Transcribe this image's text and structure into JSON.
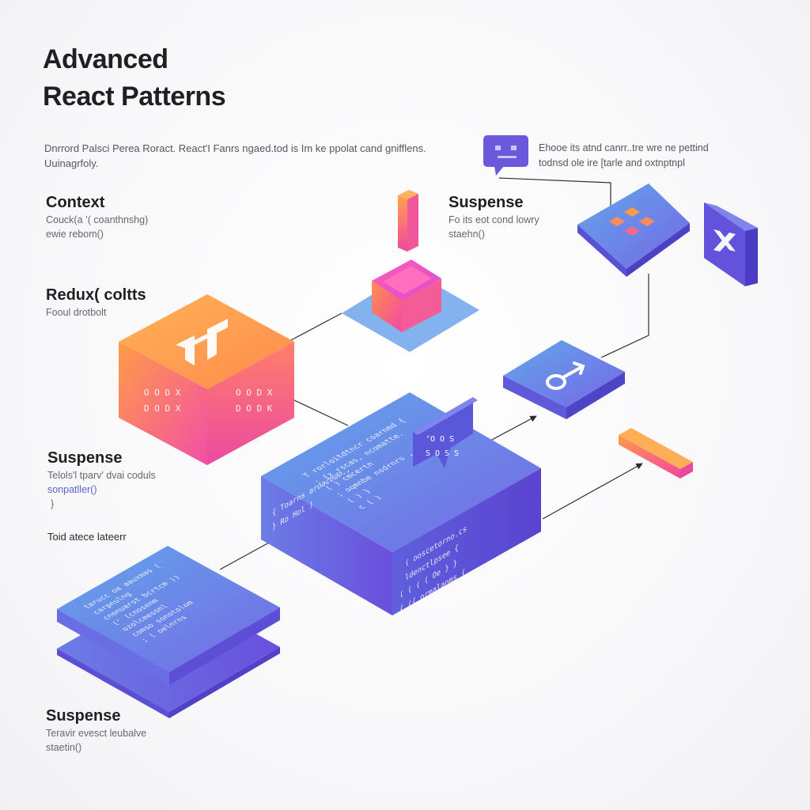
{
  "title": {
    "line1": "Advanced",
    "line2": "React Patterns"
  },
  "intro": {
    "line1": "Dnrrord Palsci Perea Roract. React'I Fanrs ngaed.tod is Im ke ppolat cand gnifflens.",
    "line2": "Uuinagrfoly."
  },
  "labels": {
    "context": {
      "heading": "Context",
      "line1": "Couck(a ’( coanthnshg)",
      "line2": "ewie rebom()"
    },
    "suspense_top": {
      "heading": "Suspense",
      "line1": "Fo its eot cond lowry",
      "line2": "staehn()"
    },
    "redux": {
      "heading": "Redux( coltts",
      "line1": "Fooul drotbolt"
    },
    "suspense_mid": {
      "heading": "Suspense",
      "line1": "Telols'l tparv' dvai coduls",
      "line2": "sonpatller()",
      "line3": "}"
    },
    "tool": {
      "heading": "Toid atece lateerr"
    },
    "suspense_bottom": {
      "heading": "Suspense",
      "line1": "Teravir evesct leubalve",
      "line2": "staetin()"
    }
  },
  "callout": {
    "line1": "Ehooe its atnd canrr..tre wre ne pettind",
    "line2": "todnsd ole ire [tarle and oxtnptnpl"
  },
  "blocks": {
    "big_cube_face": [
      "O O D X",
      "D O D X"
    ],
    "big_cube_side": [
      "O O D X",
      "D O D K"
    ],
    "bubble_code": [
      "‘O O S",
      "S O S S"
    ],
    "center_code": [
      "T rorloitdtncr coarnmd  {",
      ": {z rscas, ncomatte.",
      "( )   cmcertn",
      "; oqmnbe nsdrnrs  ,",
      "(   )        }",
      "c ( )",
      "{ Toarns aroacodo.,",
      "}  Ro Hol )",
      "(   ooscetorno.cs",
      "   ldenctlpsee {",
      "( (    (  ( Oe } }",
      "{ ({ ormalanms {"
    ],
    "stack_code": [
      "tarucc oa aauxmas  (",
      "  carpnulng",
      "cnonuarst bcrtcm   ))",
      "  (' (cnosenm",
      "   ozolcmesonl",
      "   comso  sonotolom",
      "   ; (  oelnrns"
    ]
  },
  "colors": {
    "accent_purple": "#6a55e0",
    "accent_blue": "#5b93e8",
    "accent_orange": "#ff9a4a",
    "accent_pink": "#f24fa6"
  }
}
